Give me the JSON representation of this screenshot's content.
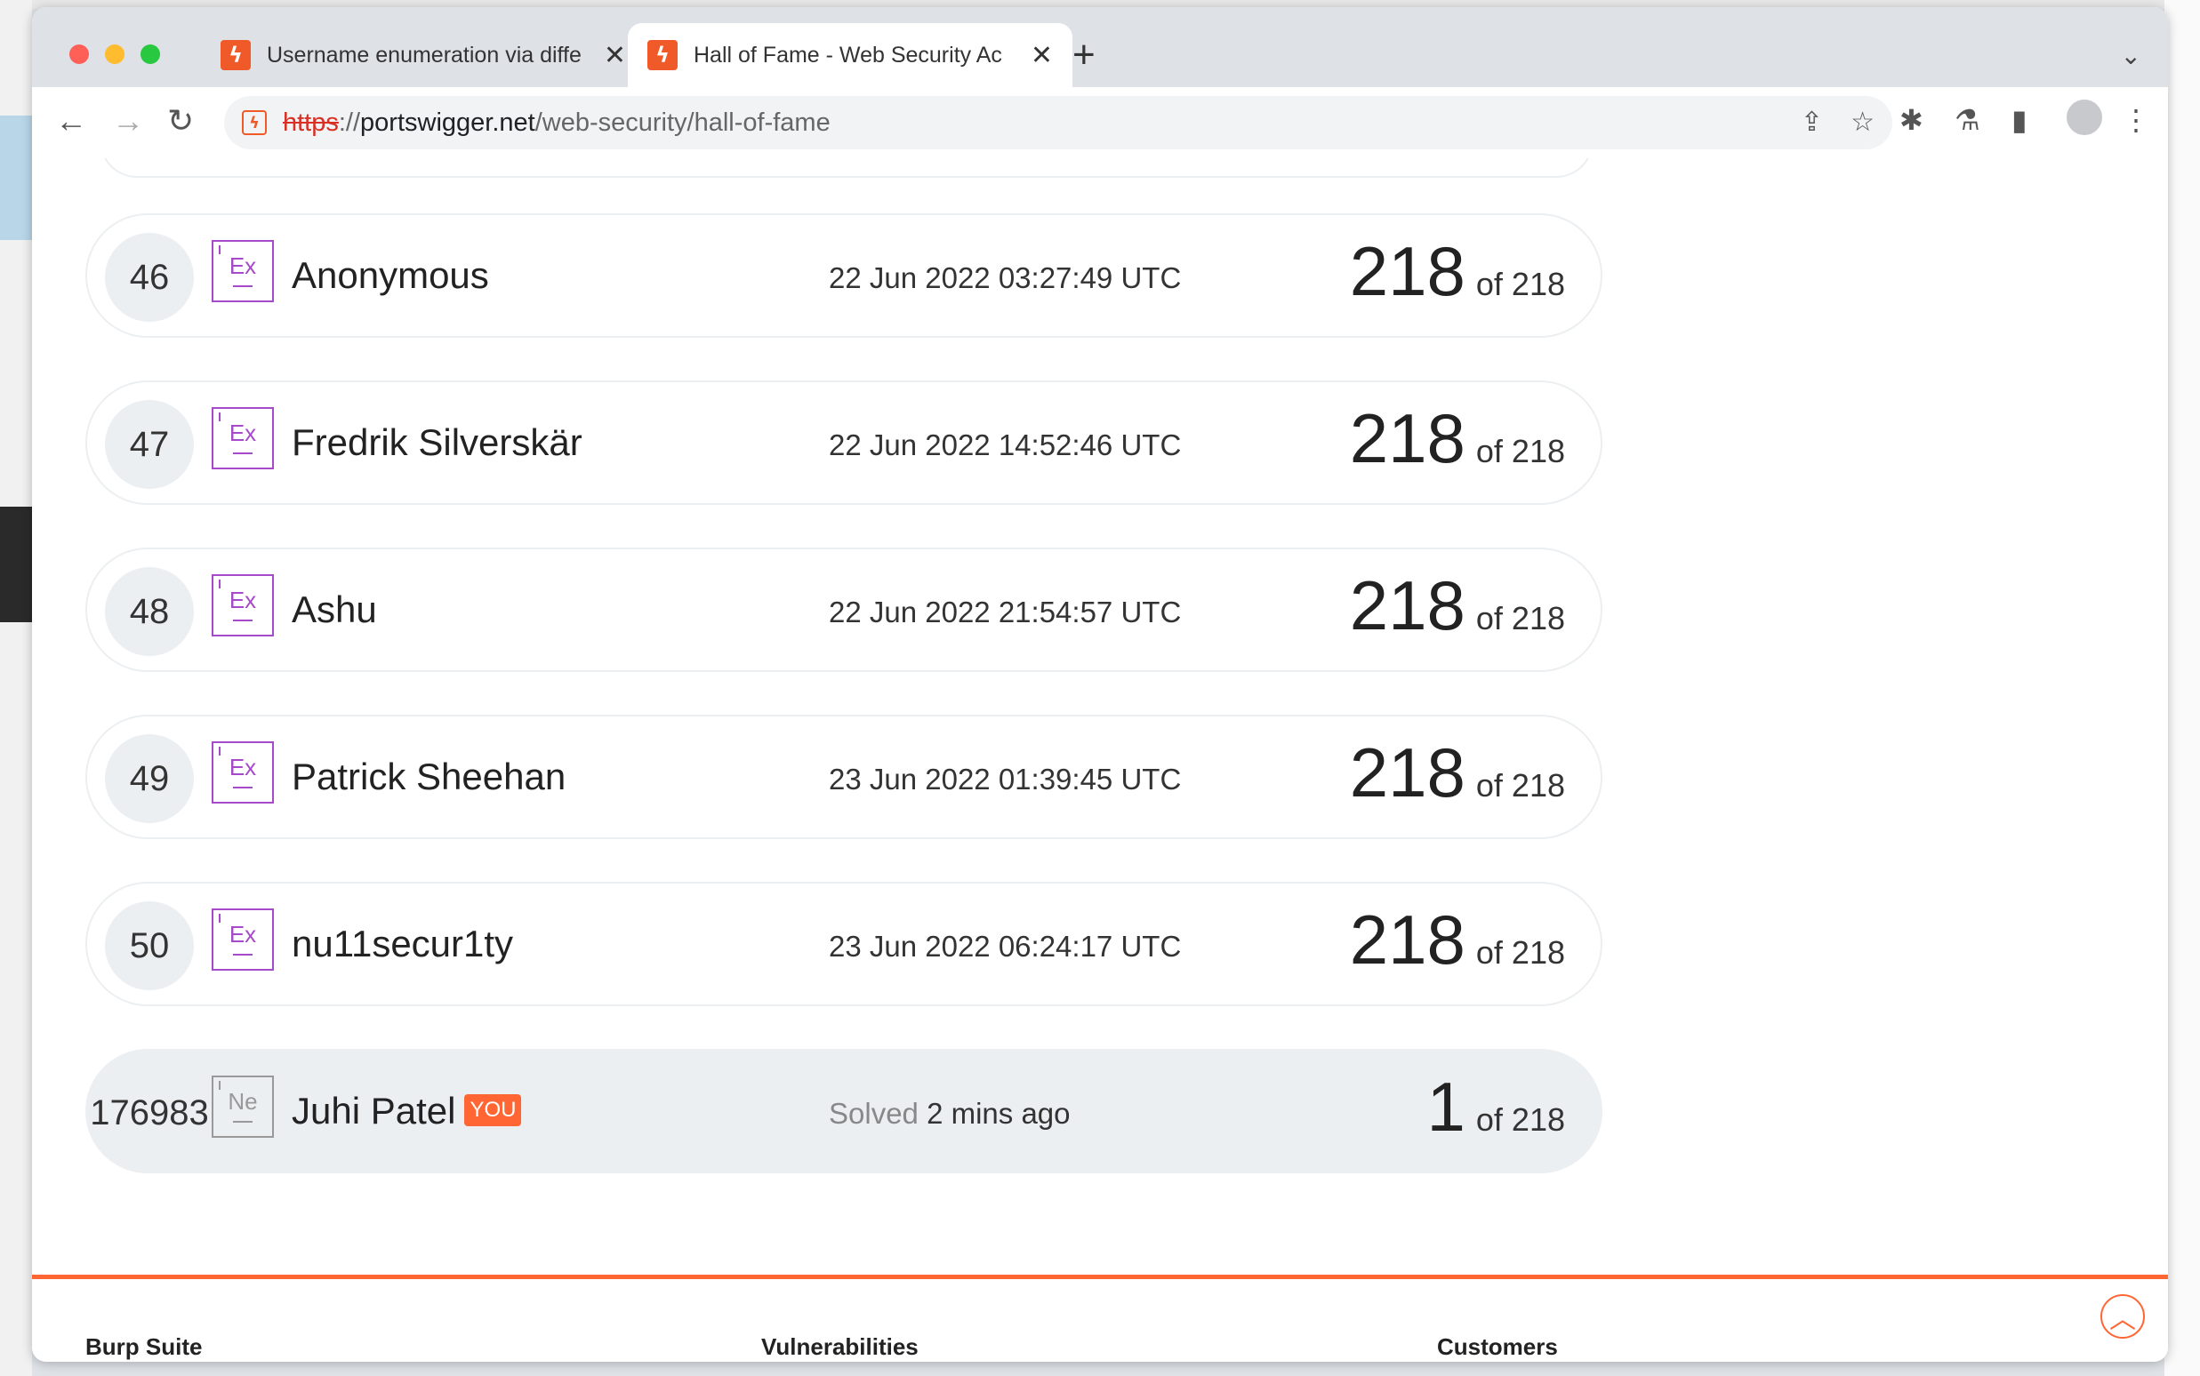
{
  "browser": {
    "tabs": [
      {
        "title": "Username enumeration via diffe",
        "favicon": "portswigger-icon",
        "active": false
      },
      {
        "title": "Hall of Fame - Web Security Ac",
        "favicon": "portswigger-icon",
        "active": true
      }
    ],
    "new_tab": "+",
    "url": {
      "scheme": "https",
      "sep": "://",
      "host": "portswigger.net",
      "path": "/web-security/hall-of-fame"
    }
  },
  "leaderboard": {
    "rows": [
      {
        "rank": "46",
        "badge": "Ex",
        "name": "Anonymous",
        "date": "22 Jun 2022 03:27:49 UTC",
        "score": "218",
        "of": "of 218"
      },
      {
        "rank": "47",
        "badge": "Ex",
        "name": "Fredrik Silverskär",
        "date": "22 Jun 2022 14:52:46 UTC",
        "score": "218",
        "of": "of 218"
      },
      {
        "rank": "48",
        "badge": "Ex",
        "name": "Ashu",
        "date": "22 Jun 2022 21:54:57 UTC",
        "score": "218",
        "of": "of 218"
      },
      {
        "rank": "49",
        "badge": "Ex",
        "name": "Patrick Sheehan",
        "date": "23 Jun 2022 01:39:45 UTC",
        "score": "218",
        "of": "of 218"
      },
      {
        "rank": "50",
        "badge": "Ex",
        "name": "nu11secur1ty",
        "date": "23 Jun 2022 06:24:17 UTC",
        "score": "218",
        "of": "of 218"
      }
    ],
    "you": {
      "rank": "176983",
      "badge": "Ne",
      "name": "Juhi Patel",
      "tag": "YOU",
      "solved_label": "Solved",
      "solved_when": "2 mins ago",
      "score": "1",
      "of": "of 218"
    }
  },
  "footer": {
    "columns": [
      "Burp Suite",
      "Vulnerabilities",
      "Customers"
    ]
  },
  "colors": {
    "accent": "#ff6633",
    "expert_badge": "#a64ac9",
    "row_border": "#eceff1"
  }
}
